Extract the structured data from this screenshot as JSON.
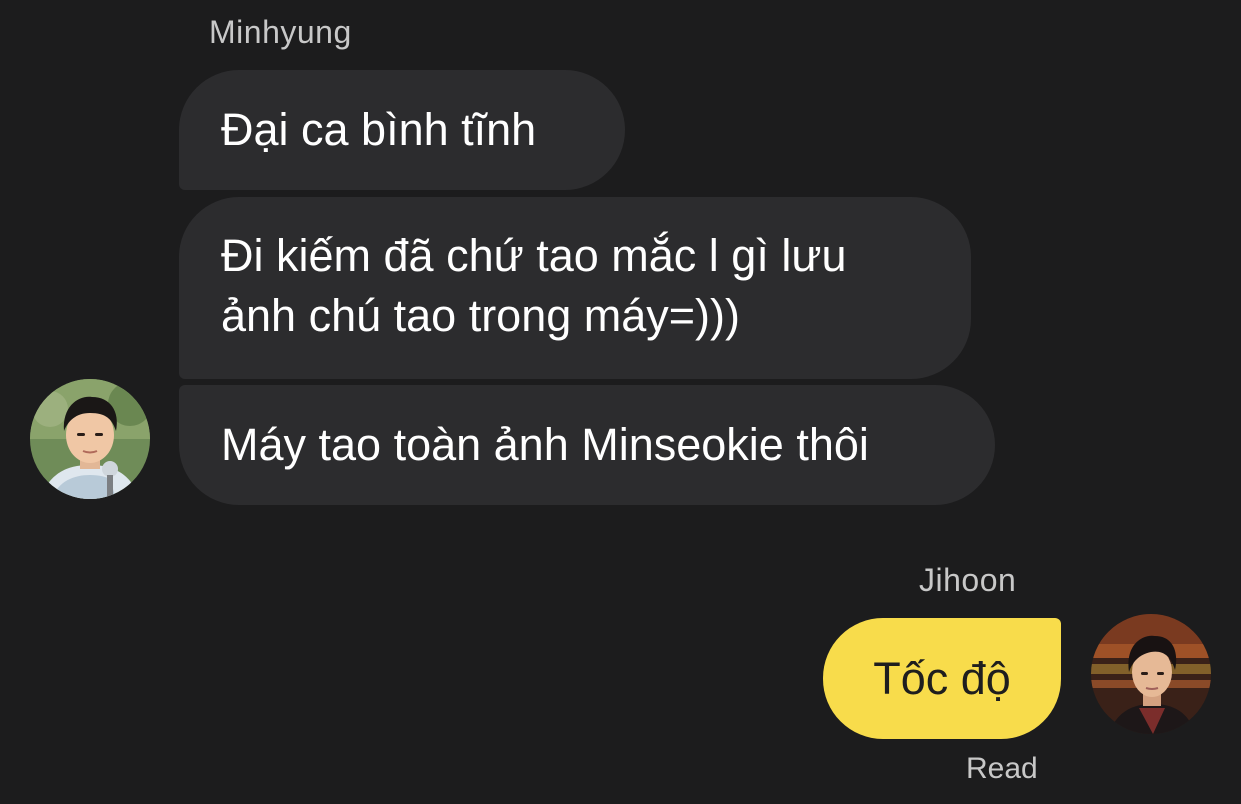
{
  "chat": {
    "incoming": {
      "sender": "Minhyung",
      "messages": [
        {
          "lines": [
            "Đại ca bình tĩnh"
          ]
        },
        {
          "lines": [
            "Đi kiếm đã chứ tao mắc l gì lưu",
            "ảnh chú tao trong máy=)))"
          ]
        },
        {
          "lines": [
            "Máy tao toàn ảnh Minseokie thôi"
          ]
        }
      ]
    },
    "outgoing": {
      "sender": "Jihoon",
      "messages": [
        {
          "lines": [
            "Tốc độ"
          ]
        }
      ],
      "status": "Read"
    }
  },
  "colors": {
    "background": "#1c1c1d",
    "incoming_bubble": "#2c2c2e",
    "outgoing_bubble": "#f8dc4b",
    "name_text": "#c8c8c8"
  }
}
